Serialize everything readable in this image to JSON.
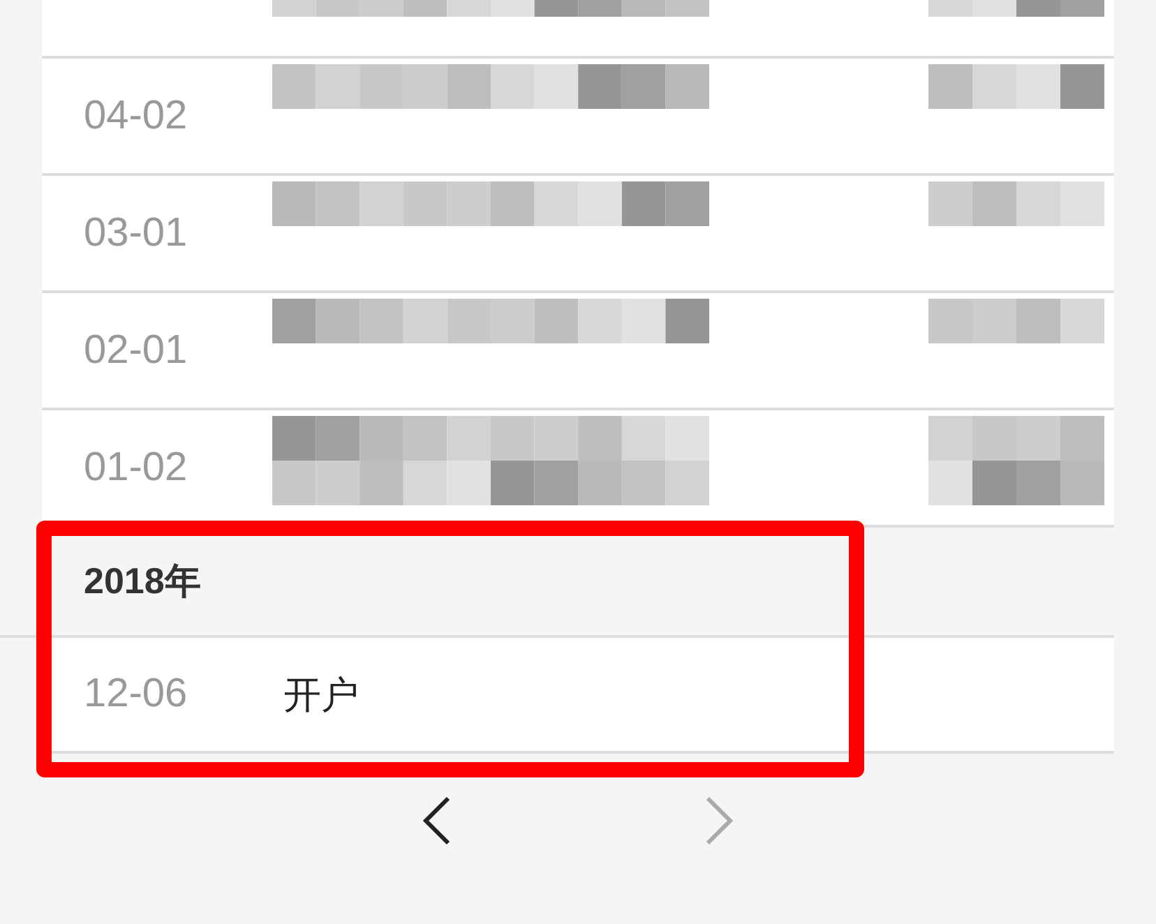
{
  "transactions": [
    {
      "kind": "partial"
    },
    {
      "kind": "single",
      "date": "04-02"
    },
    {
      "kind": "single",
      "date": "03-01"
    },
    {
      "kind": "single",
      "date": "02-01"
    },
    {
      "kind": "double",
      "date": "01-02"
    }
  ],
  "years": [
    {
      "label": "2018年",
      "highlighted": true,
      "entries": [
        {
          "date": "12-06",
          "description": "开户"
        }
      ]
    }
  ],
  "pager": {
    "prev": {
      "disabled": false
    },
    "next": {
      "disabled": true
    }
  }
}
